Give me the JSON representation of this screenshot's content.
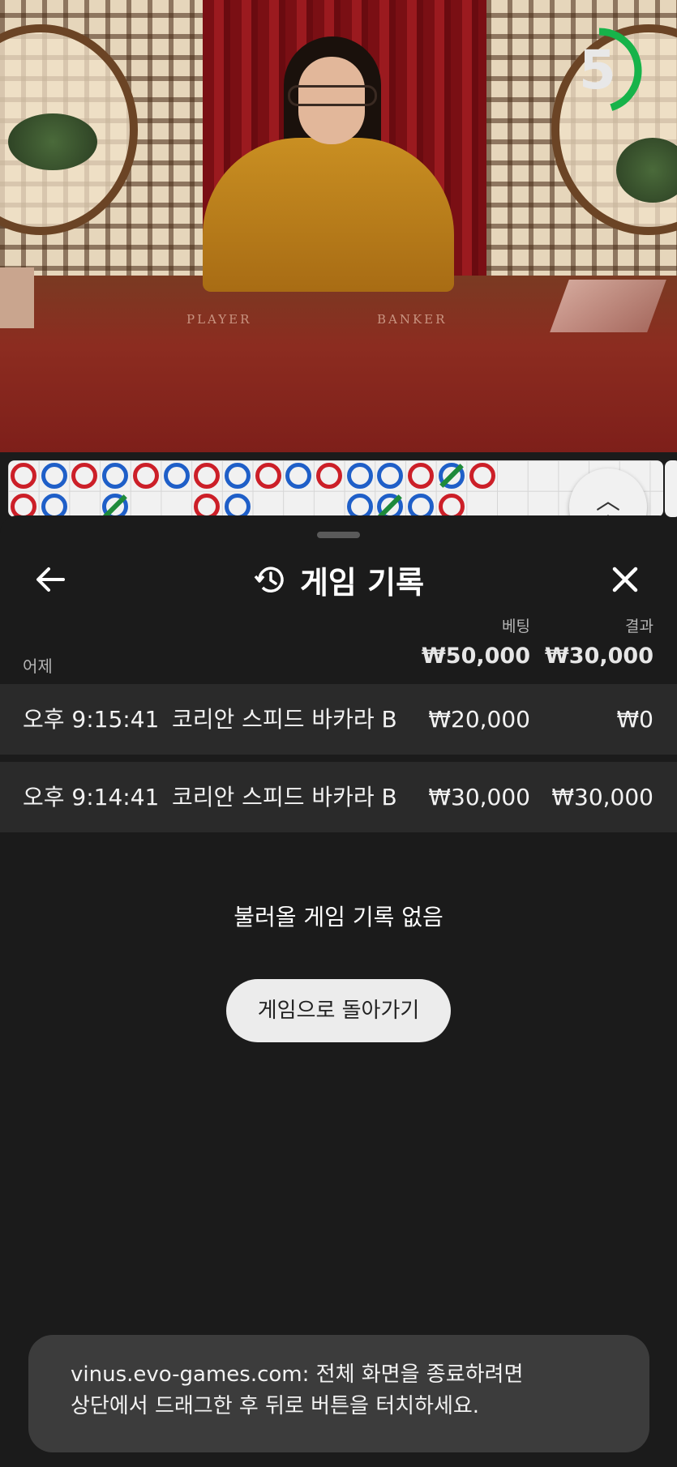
{
  "video": {
    "table_left_label": "PLAYER",
    "table_right_label": "BANKER",
    "countdown": "5",
    "countdown_progress": 0.45,
    "colors": {
      "timer_ring": "#17b34a"
    }
  },
  "roadmap": {
    "top_row": [
      "r",
      "b",
      "r",
      "b",
      "r",
      "b",
      "r",
      "b",
      "r",
      "b",
      "r",
      "b",
      "b",
      "r",
      "b",
      "r"
    ],
    "bottom_row_note": "partial beads visible",
    "colors": {
      "player": "#1f5fc8",
      "banker": "#cc1f28",
      "tie": "#1e8a3a"
    }
  },
  "history": {
    "title": "게임 기록",
    "column_bet": "베팅",
    "column_result": "결과",
    "day_label": "어제",
    "total_bet": "₩50,000",
    "total_result": "₩30,000",
    "rows": [
      {
        "time": "오후 9:15:41",
        "game": "코리안 스피드 바카라 B",
        "bet": "₩20,000",
        "result": "₩0"
      },
      {
        "time": "오후 9:14:41",
        "game": "코리안 스피드 바카라 B",
        "bet": "₩30,000",
        "result": "₩30,000"
      }
    ],
    "empty_message": "불러올 게임 기록 없음",
    "return_button": "게임으로 돌아가기"
  },
  "toast": {
    "line1": "vinus.evo-games.com: 전체 화면을 종료하려면",
    "line2": "상단에서 드래그한 후 뒤로 버튼을 터치하세요."
  },
  "icons": {
    "back": "arrow-left-icon",
    "close": "close-icon",
    "history": "history-icon",
    "expand": "chevron-up-double-icon"
  }
}
